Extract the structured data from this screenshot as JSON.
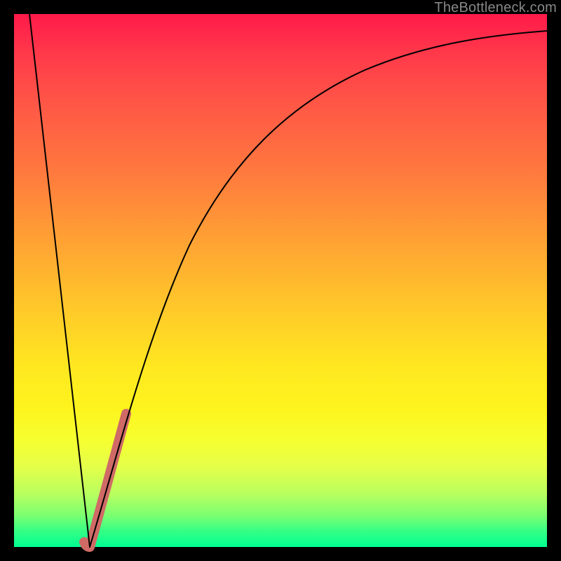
{
  "watermark": "TheBottleneck.com",
  "chart_data": {
    "type": "line",
    "title": "",
    "xlabel": "",
    "ylabel": "",
    "xlim": [
      0,
      100
    ],
    "ylim": [
      0,
      100
    ],
    "grid": false,
    "legend": false,
    "series": [
      {
        "name": "left-falling-line",
        "stroke": "#000000",
        "x": [
          3,
          14
        ],
        "values": [
          100,
          0
        ]
      },
      {
        "name": "rising-curve",
        "stroke": "#000000",
        "x": [
          14,
          16,
          18,
          20,
          22,
          25,
          28,
          32,
          36,
          40,
          45,
          50,
          56,
          63,
          72,
          82,
          92,
          100
        ],
        "values": [
          0,
          7,
          15,
          22,
          29,
          38,
          46,
          55,
          62,
          68,
          74,
          78,
          82,
          86,
          89,
          91,
          93,
          94
        ]
      },
      {
        "name": "highlight-segment",
        "stroke": "#cf6a66",
        "x": [
          13,
          14,
          15,
          16,
          17,
          18,
          19,
          20,
          21
        ],
        "values": [
          1,
          0,
          3,
          7,
          11,
          15,
          18,
          22,
          25
        ]
      }
    ],
    "background_gradient": {
      "direction": "top-to-bottom",
      "stops": [
        {
          "pos": 0.0,
          "color": "#ff1a4a"
        },
        {
          "pos": 0.3,
          "color": "#ff7a3e"
        },
        {
          "pos": 0.55,
          "color": "#ffc82a"
        },
        {
          "pos": 0.8,
          "color": "#f6ff30"
        },
        {
          "pos": 1.0,
          "color": "#00ff93"
        }
      ]
    }
  }
}
